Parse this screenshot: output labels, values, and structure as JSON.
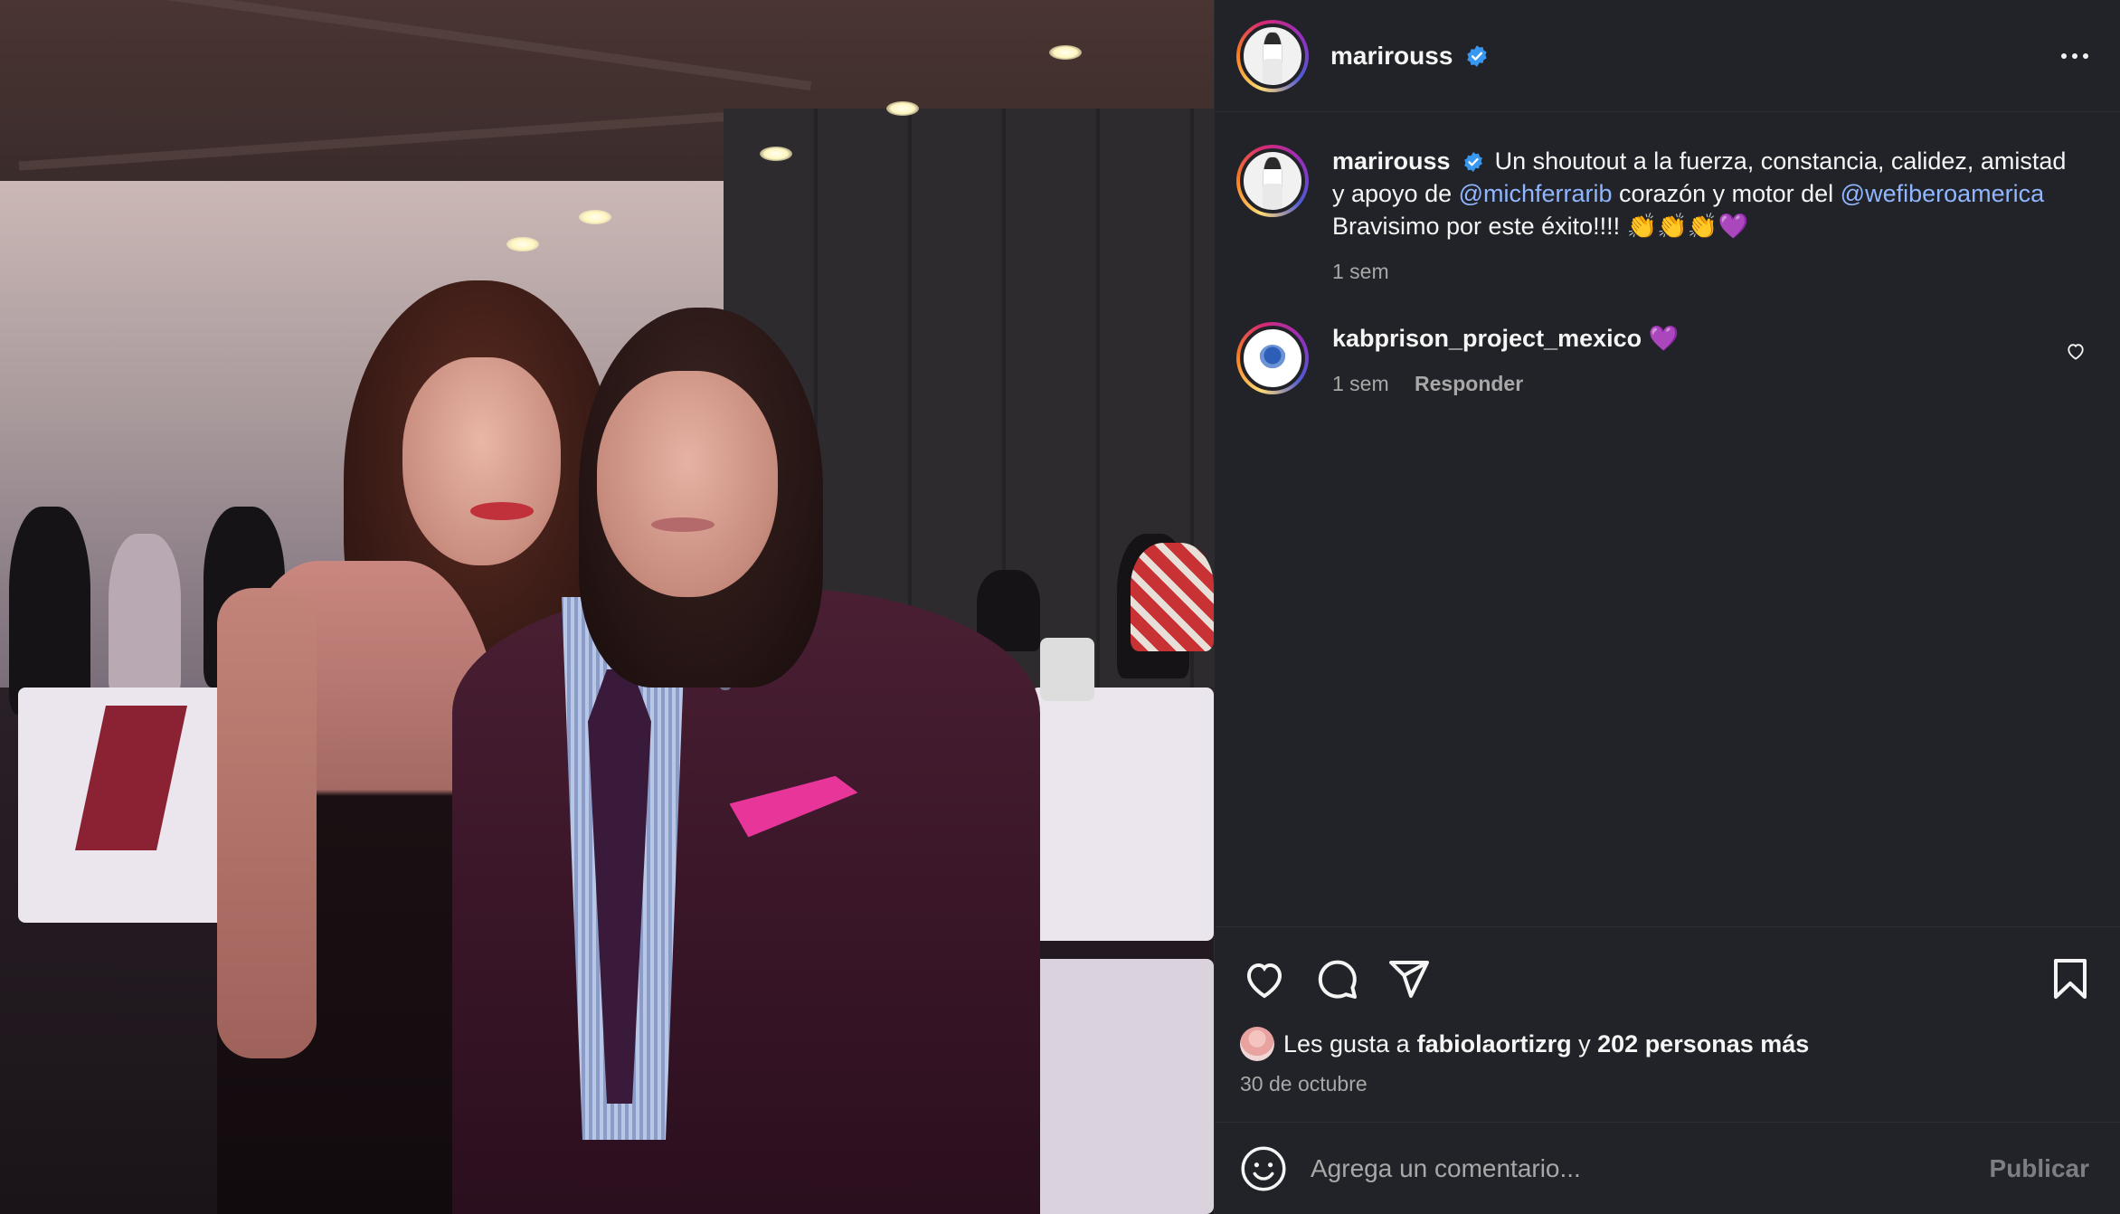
{
  "post": {
    "author": {
      "username": "marirouss",
      "verified": true,
      "avatar_icon": "profile-photo"
    },
    "more_icon": "more-horizontal-icon",
    "caption": {
      "username": "marirouss",
      "text_1": "Un shoutout a la fuerza, constancia, calidez, amistad y apoyo de ",
      "mention_1": "@michferrarib",
      "text_2": " corazón y motor del ",
      "mention_2": "@wefiberoamerica",
      "text_3": " Bravisimo por este éxito!!!! 👏👏👏💜",
      "time": "1 sem"
    },
    "comments": [
      {
        "username": "kabprison_project_mexico",
        "text": "💜",
        "time": "1 sem",
        "reply_label": "Responder",
        "like_icon": "heart-outline-icon"
      }
    ],
    "actions": {
      "like_icon": "heart-outline-icon",
      "comment_icon": "comment-bubble-icon",
      "share_icon": "paper-plane-icon",
      "save_icon": "bookmark-icon"
    },
    "likes": {
      "prefix": "Les gusta a ",
      "liker": "fabiolaortizrg",
      "connector": " y ",
      "others": "202 personas más"
    },
    "date": "30 de octubre",
    "composer": {
      "placeholder": "Agrega un comentario...",
      "publish_label": "Publicar",
      "emoji_icon": "emoji-smiley-icon"
    }
  },
  "colors": {
    "panel_bg": "#212328",
    "mention": "#8fb6ff",
    "verified": "#3897f0",
    "muted_text": "#a8a8a8",
    "publish_disabled": "#7c7e85"
  }
}
